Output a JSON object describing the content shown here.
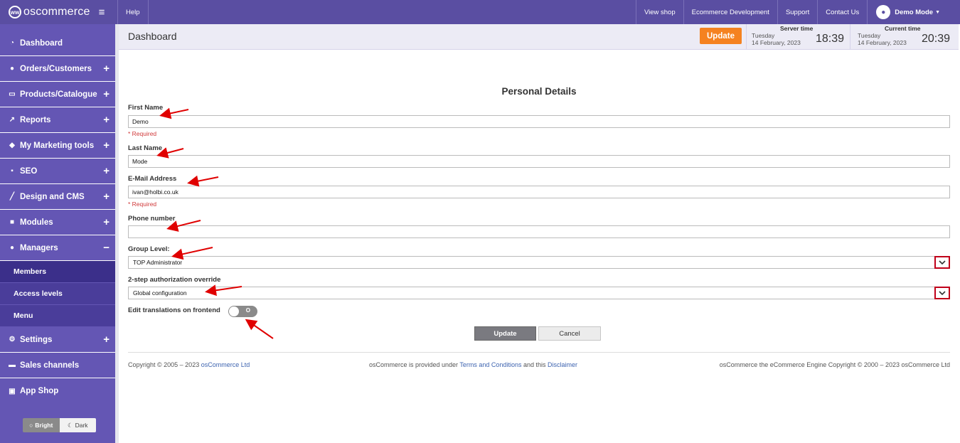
{
  "topbar": {
    "brand": "oscommerce",
    "help": "Help",
    "view_shop": "View shop",
    "ecommerce_dev": "Ecommerce Development",
    "support": "Support",
    "contact": "Contact Us",
    "user": "Demo Mode"
  },
  "sidebar": {
    "items": [
      {
        "label": "Dashboard",
        "icon": "dashboard-icon"
      },
      {
        "label": "Orders/Customers",
        "icon": "users-icon"
      },
      {
        "label": "Products/Catalogue",
        "icon": "folder-icon"
      },
      {
        "label": "Reports",
        "icon": "chart-icon"
      },
      {
        "label": "My Marketing tools",
        "icon": "tag-icon"
      },
      {
        "label": "SEO",
        "icon": "sitemap-icon"
      },
      {
        "label": "Design and CMS",
        "icon": "brush-icon"
      },
      {
        "label": "Modules",
        "icon": "puzzle-icon"
      },
      {
        "label": "Managers",
        "icon": "user-icon"
      },
      {
        "label": "Settings",
        "icon": "gears-icon"
      },
      {
        "label": "Sales channels",
        "icon": "monitor-icon"
      },
      {
        "label": "App Shop",
        "icon": "cart-icon"
      }
    ],
    "managers_sub": [
      "Members",
      "Access levels",
      "Menu"
    ],
    "theme_bright": "Bright",
    "theme_dark": "Dark"
  },
  "header": {
    "title": "Dashboard",
    "update": "Update",
    "server_label": "Server time",
    "server_day": "Tuesday",
    "server_date": "14 February, 2023",
    "server_time": "18:39",
    "current_label": "Current time",
    "current_day": "Tuesday",
    "current_date": "14 February, 2023",
    "current_time": "20:39"
  },
  "form": {
    "title": "Personal Details",
    "first_name_label": "First Name",
    "first_name_value": "Demo",
    "required": "* Required",
    "last_name_label": "Last Name",
    "last_name_value": "Mode",
    "email_label": "E-Mail Address",
    "email_value": "ivan@holbi.co.uk",
    "phone_label": "Phone number",
    "phone_value": "",
    "group_label": "Group Level:",
    "group_value": "TOP Administrator",
    "twostep_label": "2-step authorization override",
    "twostep_value": "Global configuration",
    "translations_label": "Edit translations on frontend",
    "toggle_text": "O",
    "update_button": "Update",
    "cancel_button": "Cancel"
  },
  "footer": {
    "copyright": "Copyright © 2005 – 2023 ",
    "company": "osCommerce Ltd",
    "provided_pre": "osCommerce is provided under ",
    "terms": "Terms and Conditions",
    "and_this": " and this ",
    "disclaimer": "Disclaimer",
    "engine": "osCommerce the eCommerce Engine Copyright © 2000 – 2023 osCommerce Ltd"
  },
  "colors": {
    "sidebar": "#6456b4",
    "topbar": "#5a4ea2",
    "accent_orange": "#f58220",
    "arrow_red": "#e00000"
  }
}
